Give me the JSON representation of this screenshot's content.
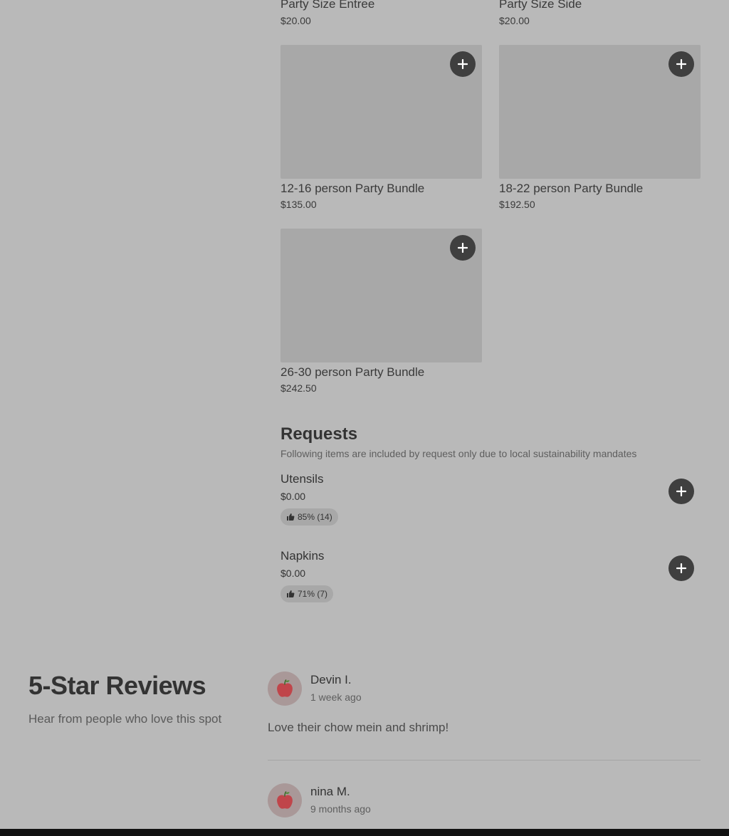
{
  "menu": {
    "items": [
      {
        "name": "Party Size Entree",
        "price": "$20.00"
      },
      {
        "name": "Party Size Side",
        "price": "$20.00"
      },
      {
        "name": "12-16 person Party Bundle",
        "price": "$135.00"
      },
      {
        "name": "18-22 person Party Bundle",
        "price": "$192.50"
      },
      {
        "name": "26-30 person Party Bundle",
        "price": "$242.50"
      }
    ]
  },
  "requests": {
    "title": "Requests",
    "subtitle": "Following items are included by request only due to local sustainability mandates",
    "items": [
      {
        "name": "Utensils",
        "price": "$0.00",
        "rating": "85% (14)"
      },
      {
        "name": "Napkins",
        "price": "$0.00",
        "rating": "71% (7)"
      }
    ]
  },
  "reviews": {
    "title": "5-Star Reviews",
    "subtitle": "Hear from people who love this spot",
    "entries": [
      {
        "name": "Devin I.",
        "time": "1 week ago",
        "text": "Love their chow mein and shrimp!"
      },
      {
        "name": "nina M.",
        "time": "9 months ago"
      }
    ]
  },
  "icons": {
    "add": "plus-icon",
    "thumb": "thumbs-up-icon",
    "avatar": "apple-icon"
  },
  "colors": {
    "overlay_bg": "#b9b9b9",
    "button": "#3f3f3f",
    "image_placeholder": "#a8a8a8",
    "apple": "#c0454a"
  }
}
